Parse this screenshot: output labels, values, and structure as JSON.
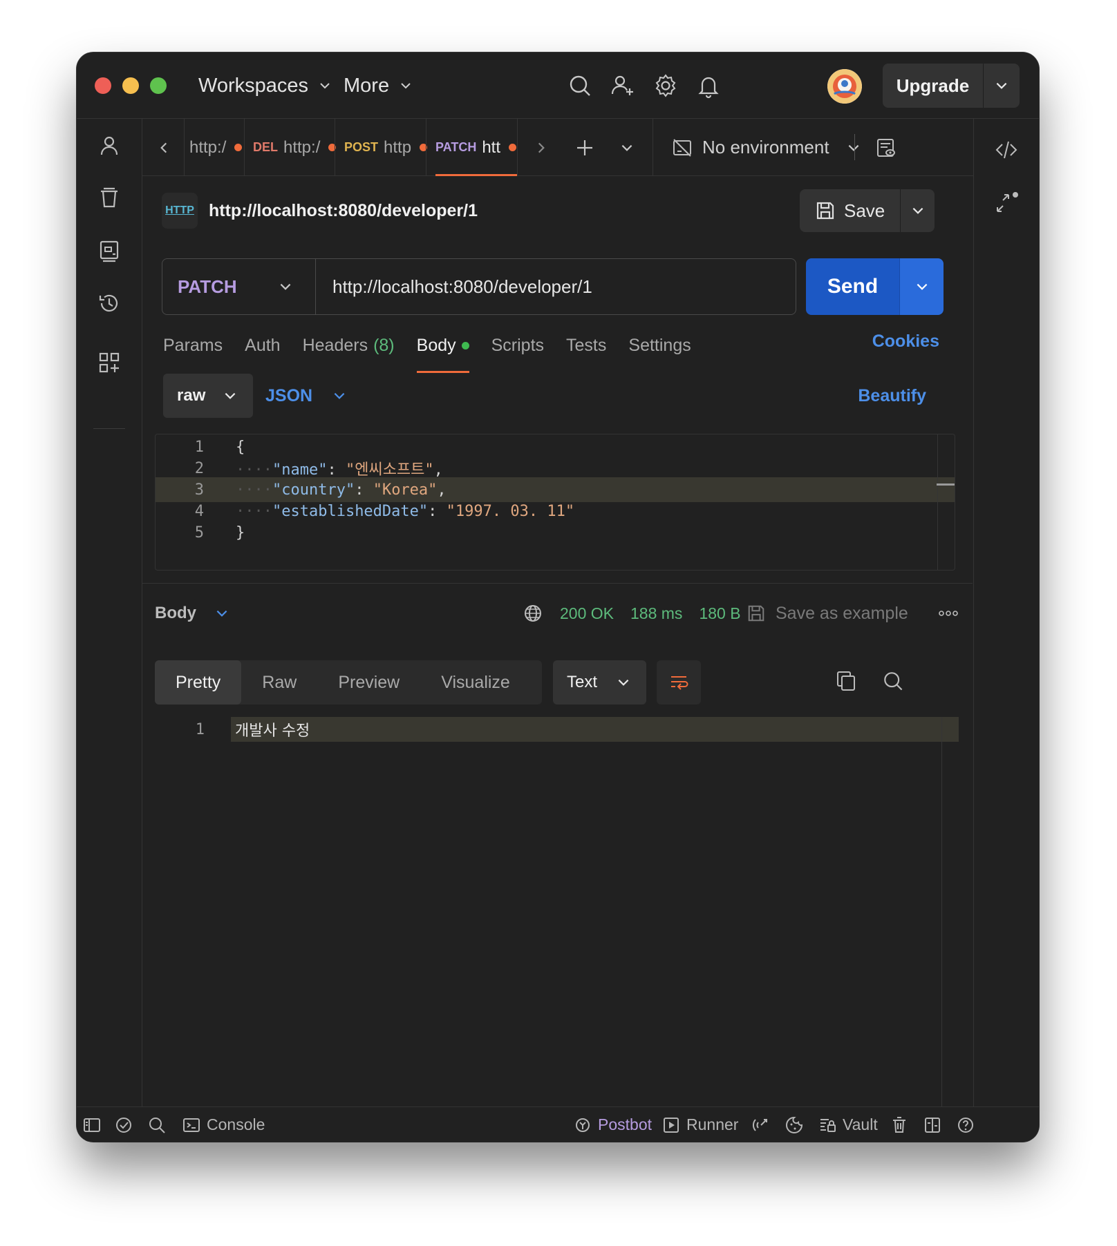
{
  "titlebar": {
    "workspaces_label": "Workspaces",
    "more_label": "More",
    "upgrade_label": "Upgrade"
  },
  "tabs": [
    {
      "method": "",
      "label": "http:/",
      "method_color": ""
    },
    {
      "method": "DEL",
      "label": "http:/",
      "method_color": "#e07a6a"
    },
    {
      "method": "POST",
      "label": "http",
      "method_color": "#e0b450"
    },
    {
      "method": "PATCH",
      "label": "htt",
      "method_color": "#b69ce0"
    }
  ],
  "environment": {
    "label": "No environment"
  },
  "request": {
    "badge": "HTTP",
    "title": "http://localhost:8080/developer/1",
    "save_label": "Save",
    "method": "PATCH",
    "url": "http://localhost:8080/developer/1",
    "send_label": "Send"
  },
  "request_tabs": {
    "params": "Params",
    "auth": "Auth",
    "headers": "Headers",
    "headers_count": "(8)",
    "body": "Body",
    "scripts": "Scripts",
    "tests": "Tests",
    "settings": "Settings",
    "cookies": "Cookies"
  },
  "body_options": {
    "mode": "raw",
    "format": "JSON",
    "beautify": "Beautify"
  },
  "editor": {
    "line_numbers": [
      "1",
      "2",
      "3",
      "4",
      "5"
    ],
    "open_brace": "{",
    "close_brace": "}",
    "fields": [
      {
        "key": "\"name\"",
        "value": "\"엔씨소프트\""
      },
      {
        "key": "\"country\"",
        "value": "\"Korea\""
      },
      {
        "key": "\"establishedDate\"",
        "value": "\"1997. 03. 11\""
      }
    ]
  },
  "response": {
    "section_label": "Body",
    "status": "200 OK",
    "time": "188 ms",
    "size": "180 B",
    "save_example": "Save as example",
    "view_tabs": [
      "Pretty",
      "Raw",
      "Preview",
      "Visualize"
    ],
    "text_format": "Text",
    "line_number": "1",
    "content": "개발사 수정"
  },
  "statusbar": {
    "console": "Console",
    "postbot": "Postbot",
    "runner": "Runner",
    "vault": "Vault"
  },
  "colors": {
    "accent_orange": "#f06b3b",
    "send_blue": "#1c58c4",
    "link_blue": "#4d8fe8",
    "status_green": "#5dbb7c",
    "patch_purple": "#b69ce0"
  }
}
